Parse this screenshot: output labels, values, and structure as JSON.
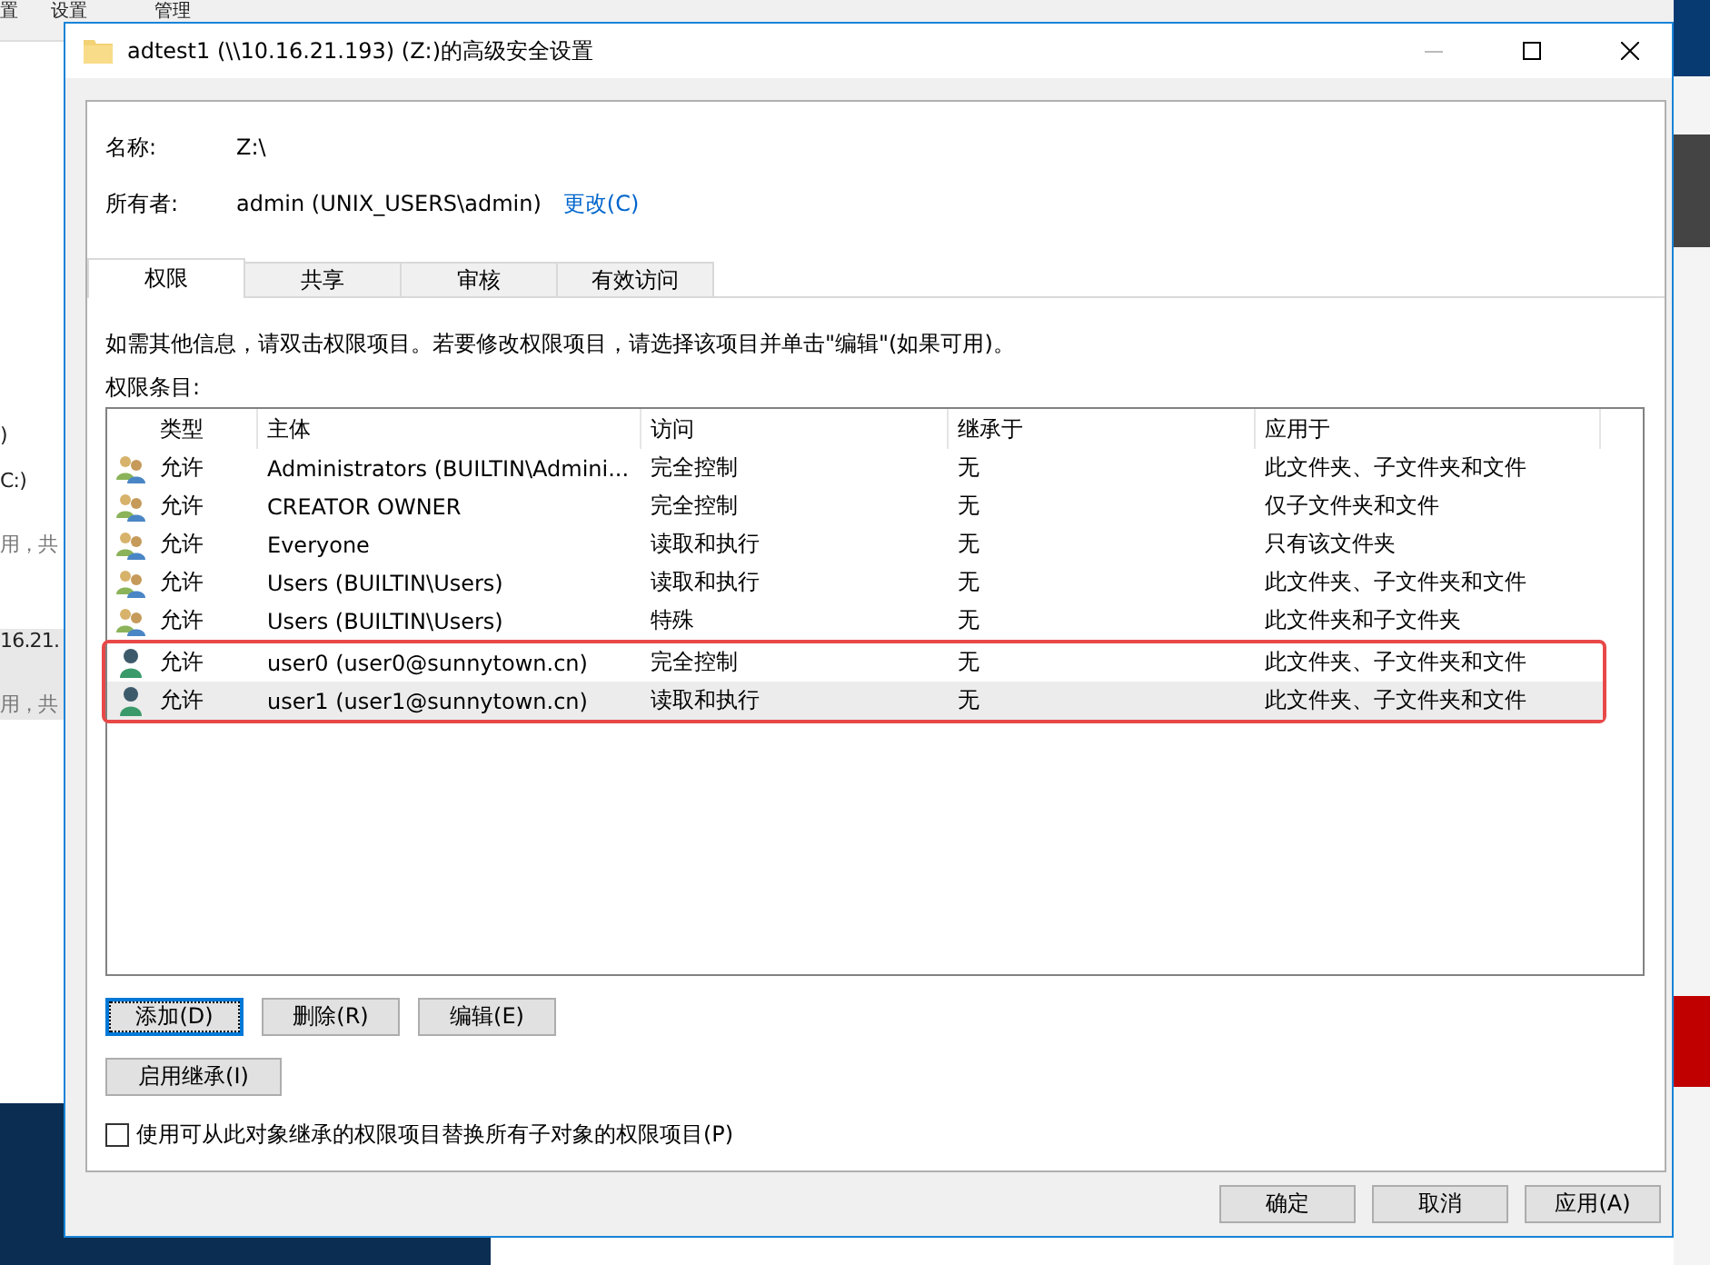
{
  "background": {
    "texts": [
      "置",
      "设置",
      "管理",
      ")",
      "C:)",
      "用，共",
      "16.21.",
      "用，共"
    ]
  },
  "window": {
    "title": "adtest1 (\\\\10.16.21.193) (Z:)的高级安全设置"
  },
  "info": [
    {
      "label": "名称:",
      "value": "Z:\\"
    },
    {
      "label": "所有者:",
      "value": "admin (UNIX_USERS\\admin)",
      "link": "更改(C)"
    }
  ],
  "tabs": [
    {
      "label": "权限",
      "selected": true
    },
    {
      "label": "共享",
      "selected": false
    },
    {
      "label": "审核",
      "selected": false
    },
    {
      "label": "有效访问",
      "selected": false
    }
  ],
  "description": "如需其他信息，请双击权限项目。若要修改权限项目，请选择该项目并单击\"编辑\"(如果可用)。",
  "list_label": "权限条目:",
  "table": {
    "columns": [
      "类型",
      "主体",
      "访问",
      "继承于",
      "应用于"
    ],
    "rows": [
      {
        "kind": "group",
        "type": "允许",
        "principal": "Administrators (BUILTIN\\Admini...",
        "access": "完全控制",
        "inherited_from": "无",
        "applies_to": "此文件夹、子文件夹和文件",
        "selected": false,
        "highlighted": false
      },
      {
        "kind": "group",
        "type": "允许",
        "principal": "CREATOR OWNER",
        "access": "完全控制",
        "inherited_from": "无",
        "applies_to": "仅子文件夹和文件",
        "selected": false,
        "highlighted": false
      },
      {
        "kind": "group",
        "type": "允许",
        "principal": "Everyone",
        "access": "读取和执行",
        "inherited_from": "无",
        "applies_to": "只有该文件夹",
        "selected": false,
        "highlighted": false
      },
      {
        "kind": "group",
        "type": "允许",
        "principal": "Users (BUILTIN\\Users)",
        "access": "读取和执行",
        "inherited_from": "无",
        "applies_to": "此文件夹、子文件夹和文件",
        "selected": false,
        "highlighted": false
      },
      {
        "kind": "group",
        "type": "允许",
        "principal": "Users (BUILTIN\\Users)",
        "access": "特殊",
        "inherited_from": "无",
        "applies_to": "此文件夹和子文件夹",
        "selected": false,
        "highlighted": false
      },
      {
        "kind": "user",
        "type": "允许",
        "principal": "user0 (user0@sunnytown.cn)",
        "access": "完全控制",
        "inherited_from": "无",
        "applies_to": "此文件夹、子文件夹和文件",
        "selected": false,
        "highlighted": true
      },
      {
        "kind": "user",
        "type": "允许",
        "principal": "user1 (user1@sunnytown.cn)",
        "access": "读取和执行",
        "inherited_from": "无",
        "applies_to": "此文件夹、子文件夹和文件",
        "selected": true,
        "highlighted": true
      }
    ]
  },
  "entry_buttons": [
    {
      "label": "添加(D)",
      "focused": true
    },
    {
      "label": "删除(R)",
      "focused": false
    },
    {
      "label": "编辑(E)",
      "focused": false
    }
  ],
  "inherit_button": "启用继承(I)",
  "replace_checkbox": {
    "label": "使用可从此对象继承的权限项目替换所有子对象的权限项目(P)",
    "checked": false
  },
  "buttons": [
    "确定",
    "取消",
    "应用(A)"
  ]
}
